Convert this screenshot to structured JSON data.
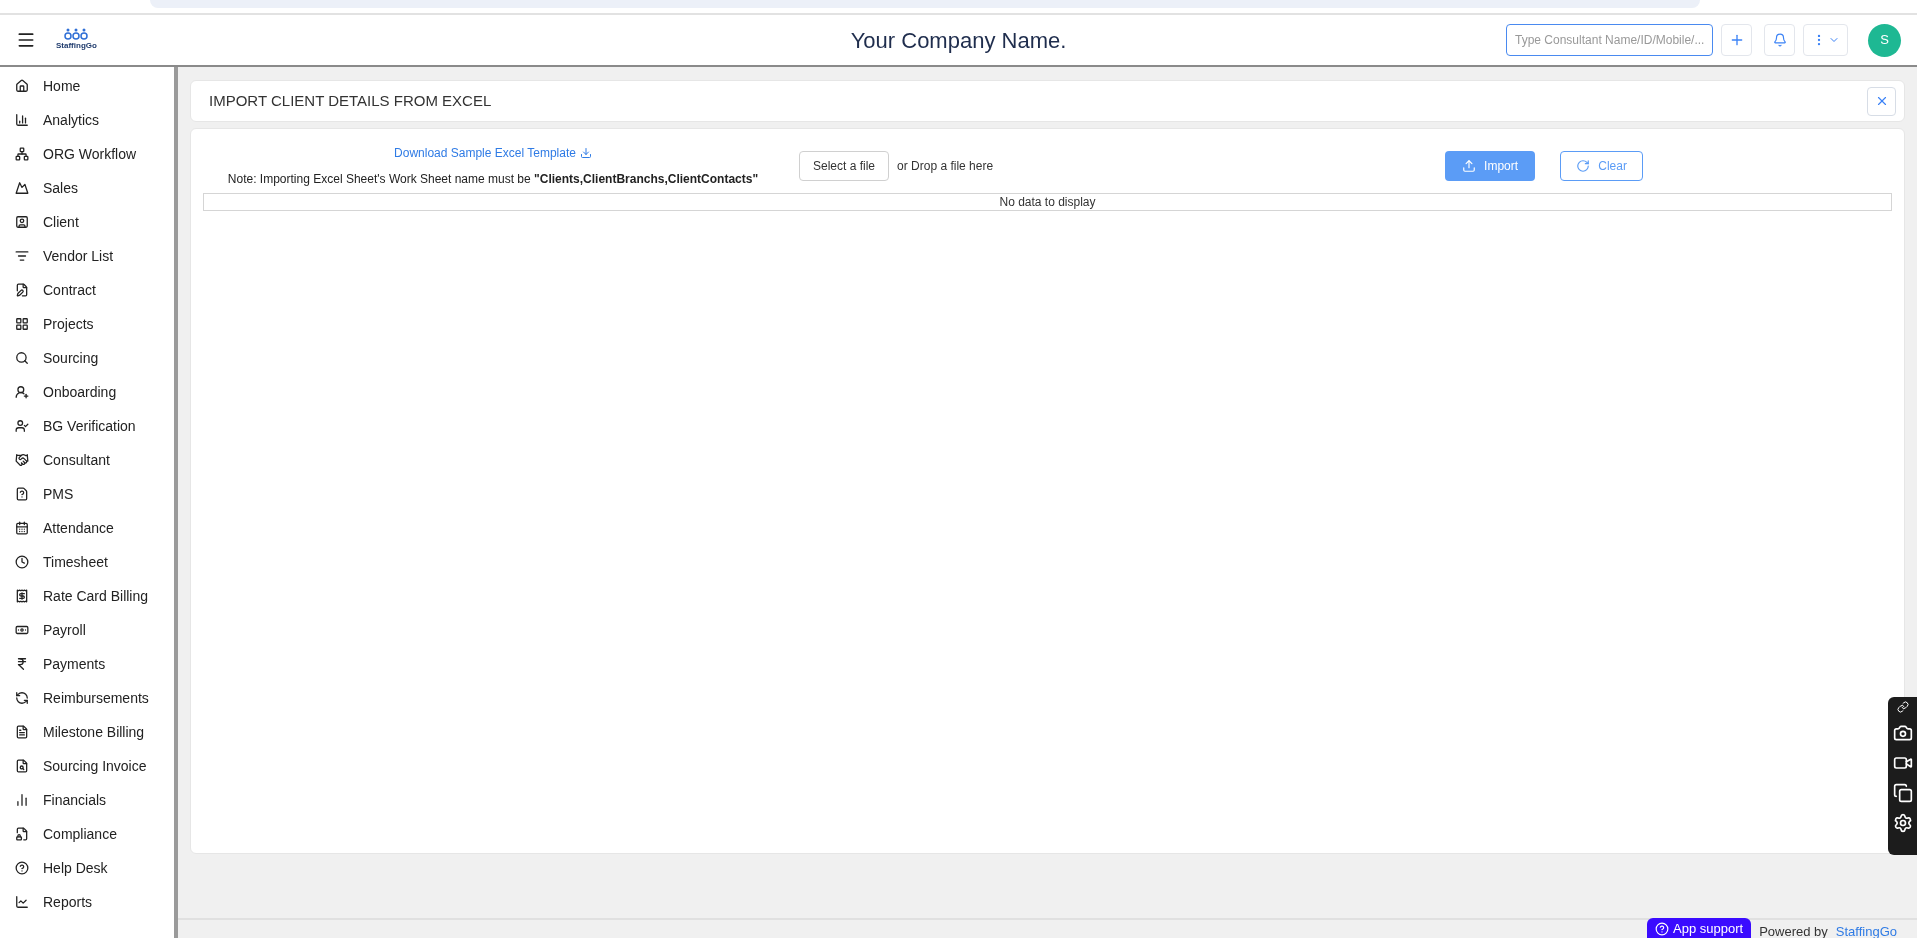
{
  "header": {
    "logo_text": "StaffingGo",
    "company_name": "Your Company Name.",
    "search": {
      "placeholder": "Type Consultant Name/ID/Mobile/..."
    },
    "avatar_initial": "S"
  },
  "sidebar": {
    "items": [
      {
        "label": "Home"
      },
      {
        "label": "Analytics"
      },
      {
        "label": "ORG Workflow"
      },
      {
        "label": "Sales"
      },
      {
        "label": "Client"
      },
      {
        "label": "Vendor List"
      },
      {
        "label": "Contract"
      },
      {
        "label": "Projects"
      },
      {
        "label": "Sourcing"
      },
      {
        "label": "Onboarding"
      },
      {
        "label": "BG Verification"
      },
      {
        "label": "Consultant"
      },
      {
        "label": "PMS"
      },
      {
        "label": "Attendance"
      },
      {
        "label": "Timesheet"
      },
      {
        "label": "Rate Card Billing"
      },
      {
        "label": "Payroll"
      },
      {
        "label": "Payments"
      },
      {
        "label": "Reimbursements"
      },
      {
        "label": "Milestone Billing"
      },
      {
        "label": "Sourcing Invoice"
      },
      {
        "label": "Financials"
      },
      {
        "label": "Compliance"
      },
      {
        "label": "Help Desk"
      },
      {
        "label": "Reports"
      }
    ]
  },
  "page": {
    "title": "IMPORT CLIENT DETAILS FROM EXCEL",
    "download_link": "Download Sample Excel Template",
    "note": "Note: Importing Excel Sheet's Work Sheet name must be **\"Clients,ClientBranchs,ClientContacts\"**",
    "select_file_button": "Select a file",
    "drop_hint": "or Drop a file here",
    "import_button": "Import",
    "clear_button": "Clear",
    "empty_message": "No data to display"
  },
  "footer": {
    "support_button": "App support",
    "powered_by": "Powered by",
    "brand_link": "StaffingGo"
  }
}
